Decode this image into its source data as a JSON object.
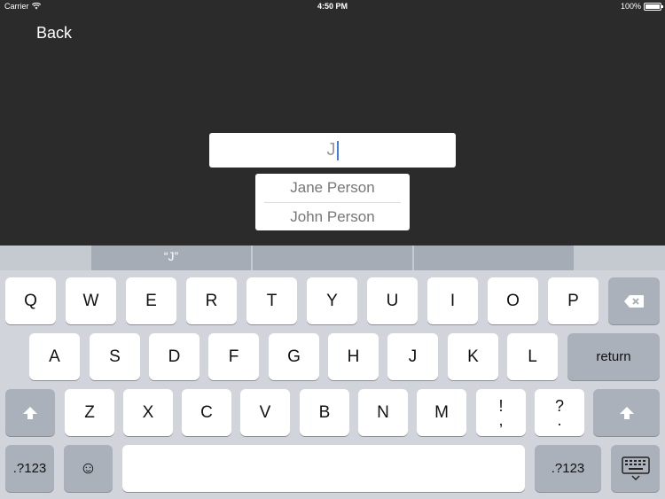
{
  "status_bar": {
    "carrier": "Carrier",
    "time": "4:50 PM",
    "battery": "100%"
  },
  "nav": {
    "back_label": "Back"
  },
  "search": {
    "value": "J"
  },
  "suggestions": [
    "Jane Person",
    "John Person"
  ],
  "keyboard": {
    "prediction": "“J”",
    "row1": [
      "Q",
      "W",
      "E",
      "R",
      "T",
      "Y",
      "U",
      "I",
      "O",
      "P"
    ],
    "row2": [
      "A",
      "S",
      "D",
      "F",
      "G",
      "H",
      "J",
      "K",
      "L"
    ],
    "return_label": "return",
    "row3": [
      "Z",
      "X",
      "C",
      "V",
      "B",
      "N",
      "M"
    ],
    "punct1": [
      "!",
      ","
    ],
    "punct2": [
      "?",
      "."
    ],
    "numbers_label": ".?123",
    "emoji": "☺",
    "icons": [
      "wifi-icon",
      "battery-icon",
      "backspace-icon",
      "shift-icon",
      "emoji-icon",
      "hide-keyboard-icon"
    ]
  }
}
